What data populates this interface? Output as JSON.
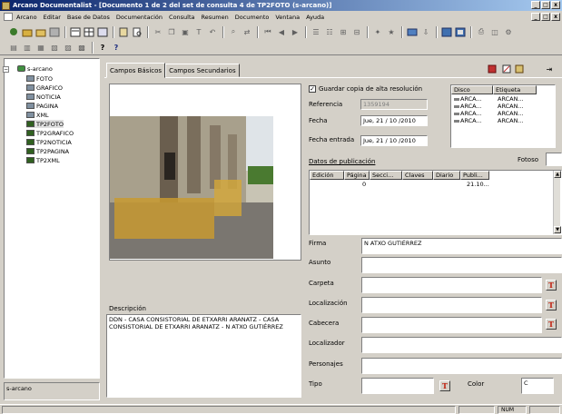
{
  "window": {
    "title": "Arcano Documentalist - [Documento 1 de 2 del set de consulta 4 de TP2FOTO (s-arcano)]",
    "controls": [
      "_",
      "□",
      "x"
    ]
  },
  "menu": [
    "Arcano",
    "Editar",
    "Base de Datos",
    "Documentación",
    "Consulta",
    "Resumen",
    "Documento",
    "Ventana",
    "Ayuda"
  ],
  "tree": {
    "root": "s-arcano",
    "items": [
      "FOTO",
      "GRAFICO",
      "NOTICIA",
      "PAGINA",
      "XML",
      "TP2FOTO",
      "TP2GRAFICO",
      "TP2NOTICIA",
      "TP2PAGINA",
      "TP2XML"
    ],
    "selected": "TP2FOTO",
    "status": "s-arcano"
  },
  "tabs": [
    "Campos Básicos",
    "Campos Secundarios"
  ],
  "form": {
    "guardar_label": "Guardar copia de alta resolución",
    "guardar_checked": "✓",
    "referencia_label": "Referencia",
    "referencia_value": "1359194",
    "fecha_label": "Fecha",
    "fecha_value": "Jue, 21 / 10 /2010",
    "fecha_entrada_label": "Fecha entrada",
    "fecha_entrada_value": "Jue, 21 / 10 /2010",
    "datos_pub_label": "Datos de publicación",
    "fotoso_label": "Fotoso",
    "firma_label": "Firma",
    "firma_value": "N ATXO GUTIÉRREZ",
    "asunto_label": "Asunto",
    "carpeta_label": "Carpeta",
    "localizacion_label": "Localización",
    "cabecera_label": "Cabecera",
    "localizador_label": "Localizador",
    "personajes_label": "Personajes",
    "tipo_label": "Tipo",
    "color_label": "Color",
    "color_value": "C",
    "descripcion_label": "Descripción",
    "descripcion_value": "DDN - CASA CONSISTORIAL DE ETXARRI ARANATZ - CASA CONSISTORIAL DE ETXARRI ARANATZ - N ATXO GUTIÉRREZ",
    "t_icon": "T"
  },
  "disco": {
    "headers": [
      "Disco",
      "Etiqueta"
    ],
    "rows": [
      [
        "ARCA...",
        "ARCAN..."
      ],
      [
        "ARCA...",
        "ARCAN..."
      ],
      [
        "ARCA...",
        "ARCAN..."
      ],
      [
        "ARCA...",
        "ARCAN..."
      ]
    ]
  },
  "publicacion": {
    "headers": [
      "Edición",
      "Página",
      "Secci...",
      "Claves",
      "Diario",
      "Publi..."
    ],
    "row": [
      "",
      "0",
      "",
      "",
      "",
      "21.10..."
    ]
  },
  "statusbar": {
    "num": "NUM"
  }
}
